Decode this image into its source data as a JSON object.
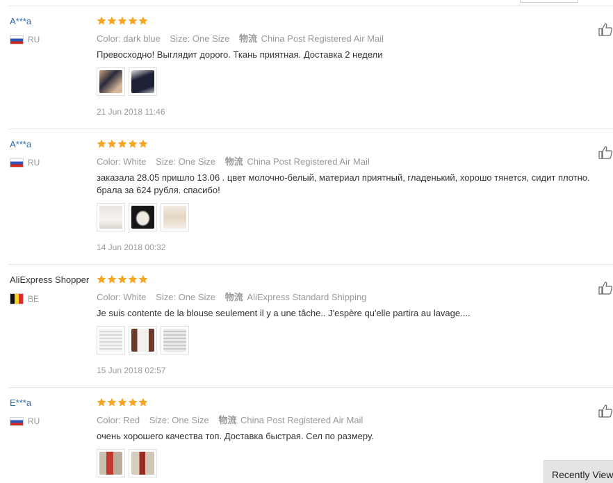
{
  "star_color": "#f5a623",
  "link_color": "#2a6ead",
  "reviews": [
    {
      "user": "A***a",
      "country": "RU",
      "rating": 5,
      "color_label": "Color: dark blue",
      "size_label": "Size: One Size",
      "ship_key": "物流",
      "ship_value": "China Post Registered Air Mail",
      "text": "Превосходно! Выглядит дорого. Ткань приятная. Доставка 2 недели",
      "date": "21 Jun 2018 11:46",
      "photos": [
        "photo",
        "photo"
      ]
    },
    {
      "user": "A***a",
      "country": "RU",
      "rating": 5,
      "color_label": "Color: White",
      "size_label": "Size: One Size",
      "ship_key": "物流",
      "ship_value": "China Post Registered Air Mail",
      "text": "заказала 28.05 пришло 13.06 . цвет молочно-белый, материал приятный, гладенький, хорошо тянется, сидит плотно. брала за 624 рубля. спасибо!",
      "date": "14 Jun 2018 00:32",
      "photos": [
        "photo",
        "photo",
        "photo"
      ]
    },
    {
      "user": "AliExpress Shopper",
      "country": "BE",
      "rating": 5,
      "color_label": "Color: White",
      "size_label": "Size: One Size",
      "ship_key": "物流",
      "ship_value": "AliExpress Standard Shipping",
      "text": "Je suis contente de la blouse seulement il y a une tâche.. J'espère qu'elle partira au lavage....",
      "date": "15 Jun 2018 02:57",
      "photos": [
        "photo",
        "photo",
        "photo"
      ]
    },
    {
      "user": "E***a",
      "country": "RU",
      "rating": 5,
      "color_label": "Color: Red",
      "size_label": "Size: One Size",
      "ship_key": "物流",
      "ship_value": "China Post Registered Air Mail",
      "text": "очень хорошего качества топ. Доставка быстрая. Сел по размеру.",
      "date": "",
      "photos": [
        "photo",
        "photo"
      ]
    }
  ],
  "recently_viewed_label": "Recently Viewed"
}
